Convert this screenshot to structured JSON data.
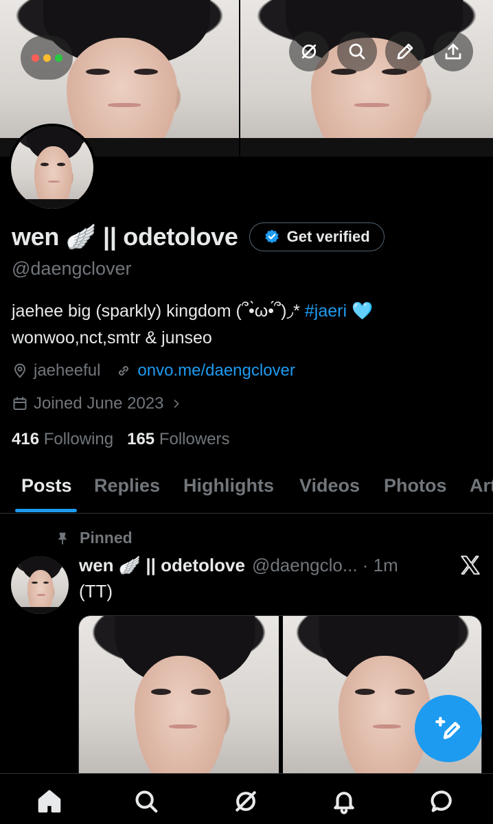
{
  "header": {
    "window_dots_colors": [
      "#ff5f57",
      "#febc2e",
      "#28c840"
    ],
    "actions": [
      {
        "name": "grok-icon"
      },
      {
        "name": "search-icon"
      },
      {
        "name": "edit-icon"
      },
      {
        "name": "share-icon"
      }
    ]
  },
  "profile": {
    "display_name": "wen 🪽 || odetolove",
    "get_verified_label": "Get verified",
    "handle": "@daengclover",
    "bio_line1": "jaehee big (sparkly) kingdom (՞•̀ω•́՞)◞*",
    "bio_hashtag": "#jaeri",
    "bio_emoji": "🩵",
    "bio_line2": "wonwoo,nct,smtr & junseo",
    "location": "jaeheeful",
    "website": "onvo.me/daengclover",
    "joined": "Joined June 2023",
    "following_count": "416",
    "following_label": "Following",
    "followers_count": "165",
    "followers_label": "Followers"
  },
  "tabs": [
    "Posts",
    "Replies",
    "Highlights",
    "Videos",
    "Photos",
    "Art"
  ],
  "active_tab": "Posts",
  "post": {
    "pinned_label": "Pinned",
    "author_name": "wen 🪽 || odetolove",
    "author_handle": "@daengclo... · 1m",
    "text": "(TT)",
    "media_count": 2
  },
  "bottom_nav": [
    {
      "name": "home-icon",
      "active": true
    },
    {
      "name": "search-icon"
    },
    {
      "name": "grok-icon"
    },
    {
      "name": "notifications-icon"
    },
    {
      "name": "messages-icon"
    }
  ],
  "colors": {
    "accent": "#1d9bf0",
    "background": "#000000",
    "text_primary": "#e7e9ea",
    "text_secondary": "#71767b"
  }
}
